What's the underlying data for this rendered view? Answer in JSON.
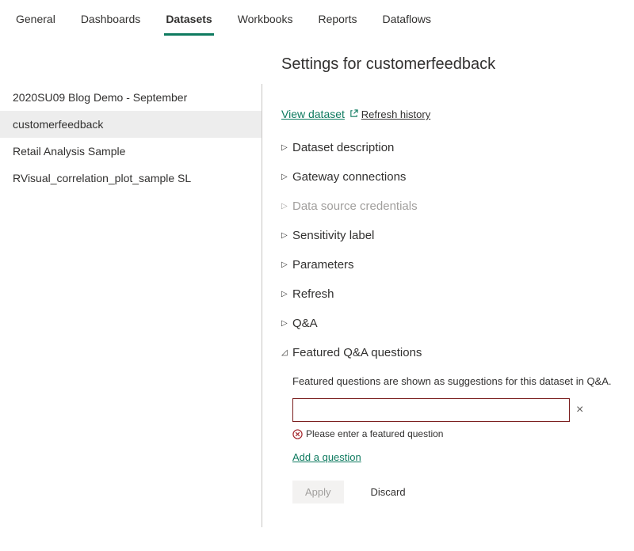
{
  "tabs": [
    {
      "label": "General"
    },
    {
      "label": "Dashboards"
    },
    {
      "label": "Datasets"
    },
    {
      "label": "Workbooks"
    },
    {
      "label": "Reports"
    },
    {
      "label": "Dataflows"
    }
  ],
  "sidebar": {
    "items": [
      {
        "label": "2020SU09 Blog Demo - September"
      },
      {
        "label": "customerfeedback"
      },
      {
        "label": "Retail Analysis Sample"
      },
      {
        "label": "RVisual_correlation_plot_sample SL"
      }
    ]
  },
  "main": {
    "title": "Settings for customerfeedback",
    "view_dataset": "View dataset",
    "refresh_history": "Refresh history",
    "sections": {
      "dataset_description": "Dataset description",
      "gateway_connections": "Gateway connections",
      "data_source_credentials": "Data source credentials",
      "sensitivity_label": "Sensitivity label",
      "parameters": "Parameters",
      "refresh": "Refresh",
      "qna": "Q&A",
      "featured_qna": "Featured Q&A questions"
    },
    "featured_qna_body": {
      "help": "Featured questions are shown as suggestions for this dataset in Q&A.",
      "input_value": "",
      "error": "Please enter a featured question",
      "add_link": "Add a question",
      "apply": "Apply",
      "discard": "Discard"
    }
  }
}
